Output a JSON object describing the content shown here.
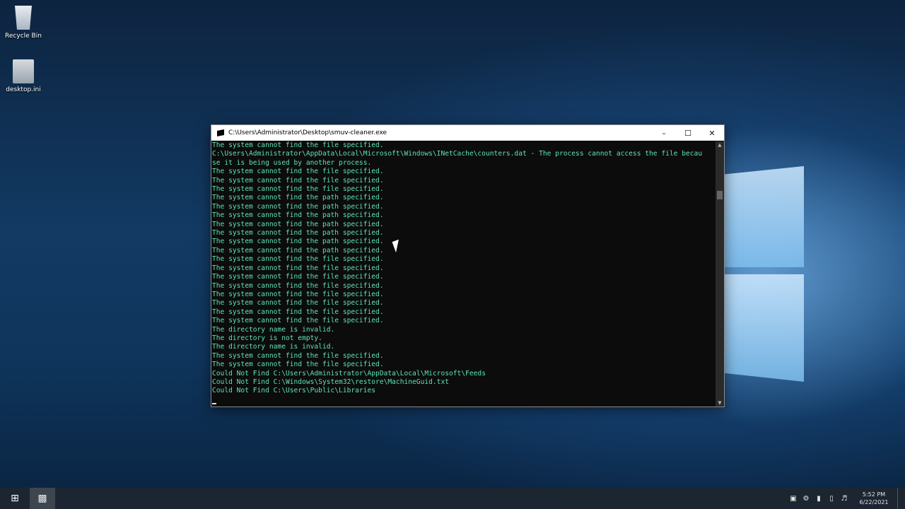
{
  "desktop": {
    "icons": [
      {
        "label": "Recycle Bin",
        "icon": "recycle-bin-icon"
      },
      {
        "label": "desktop.ini",
        "icon": "file-icon"
      }
    ]
  },
  "console": {
    "title": "C:\\Users\\Administrator\\Desktop\\smuv-cleaner.exe",
    "lines": [
      "The system cannot find the file specified.",
      "C:\\Users\\Administrator\\AppData\\Local\\Microsoft\\Windows\\INetCache\\counters.dat - The process cannot access the file becau",
      "se it is being used by another process.",
      "The system cannot find the file specified.",
      "The system cannot find the file specified.",
      "The system cannot find the file specified.",
      "The system cannot find the path specified.",
      "The system cannot find the path specified.",
      "The system cannot find the path specified.",
      "The system cannot find the path specified.",
      "The system cannot find the path specified.",
      "The system cannot find the path specified.",
      "The system cannot find the path specified.",
      "The system cannot find the file specified.",
      "The system cannot find the file specified.",
      "The system cannot find the file specified.",
      "The system cannot find the file specified.",
      "The system cannot find the file specified.",
      "The system cannot find the file specified.",
      "The system cannot find the file specified.",
      "The system cannot find the file specified.",
      "The directory name is invalid.",
      "The directory is not empty.",
      "The directory name is invalid.",
      "The system cannot find the file specified.",
      "The system cannot find the file specified.",
      "Could Not Find C:\\Users\\Administrator\\AppData\\Local\\Microsoft\\Feeds",
      "Could Not Find C:\\Windows\\System32\\restore\\MachineGuid.txt",
      "Could Not Find C:\\Users\\Public\\Libraries"
    ]
  },
  "taskbar": {
    "time": "5:52 PM",
    "date": "6/22/2021"
  }
}
